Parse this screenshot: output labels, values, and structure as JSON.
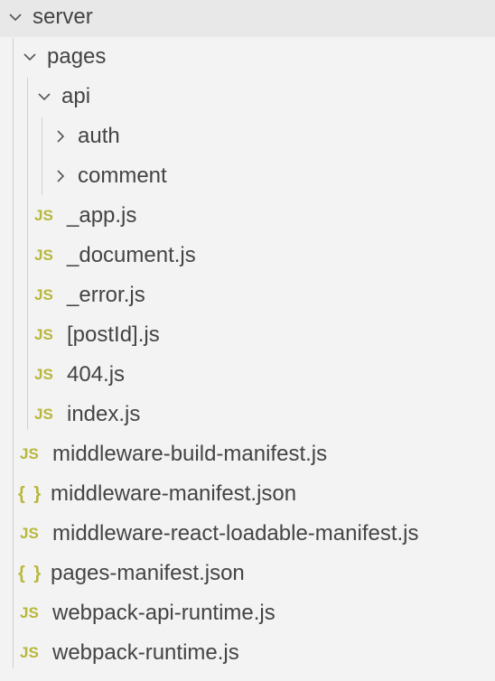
{
  "tree": {
    "root": {
      "label": "server",
      "icon": "chevron-down-icon"
    },
    "pages": {
      "label": "pages",
      "icon": "chevron-down-icon"
    },
    "api": {
      "label": "api",
      "icon": "chevron-down-icon"
    },
    "auth": {
      "label": "auth",
      "icon": "chevron-right-icon"
    },
    "comment": {
      "label": "comment",
      "icon": "chevron-right-icon"
    },
    "page_files": [
      {
        "icon_text": "JS",
        "icon": "javascript-file-icon",
        "label": "_app.js"
      },
      {
        "icon_text": "JS",
        "icon": "javascript-file-icon",
        "label": "_document.js"
      },
      {
        "icon_text": "JS",
        "icon": "javascript-file-icon",
        "label": "_error.js"
      },
      {
        "icon_text": "JS",
        "icon": "javascript-file-icon",
        "label": "[postId].js"
      },
      {
        "icon_text": "JS",
        "icon": "javascript-file-icon",
        "label": "404.js"
      },
      {
        "icon_text": "JS",
        "icon": "javascript-file-icon",
        "label": "index.js"
      }
    ],
    "server_files": [
      {
        "icon_text": "JS",
        "icon": "javascript-file-icon",
        "label": "middleware-build-manifest.js"
      },
      {
        "icon_text": "{ }",
        "icon": "json-file-icon",
        "label": "middleware-manifest.json"
      },
      {
        "icon_text": "JS",
        "icon": "javascript-file-icon",
        "label": "middleware-react-loadable-manifest.js"
      },
      {
        "icon_text": "{ }",
        "icon": "json-file-icon",
        "label": "pages-manifest.json"
      },
      {
        "icon_text": "JS",
        "icon": "javascript-file-icon",
        "label": "webpack-api-runtime.js"
      },
      {
        "icon_text": "JS",
        "icon": "javascript-file-icon",
        "label": "webpack-runtime.js"
      }
    ]
  },
  "colors": {
    "js_icon": "#b7b73b",
    "json_icon": "#b7b73b",
    "text": "#444444",
    "background": "#f3f3f3"
  }
}
